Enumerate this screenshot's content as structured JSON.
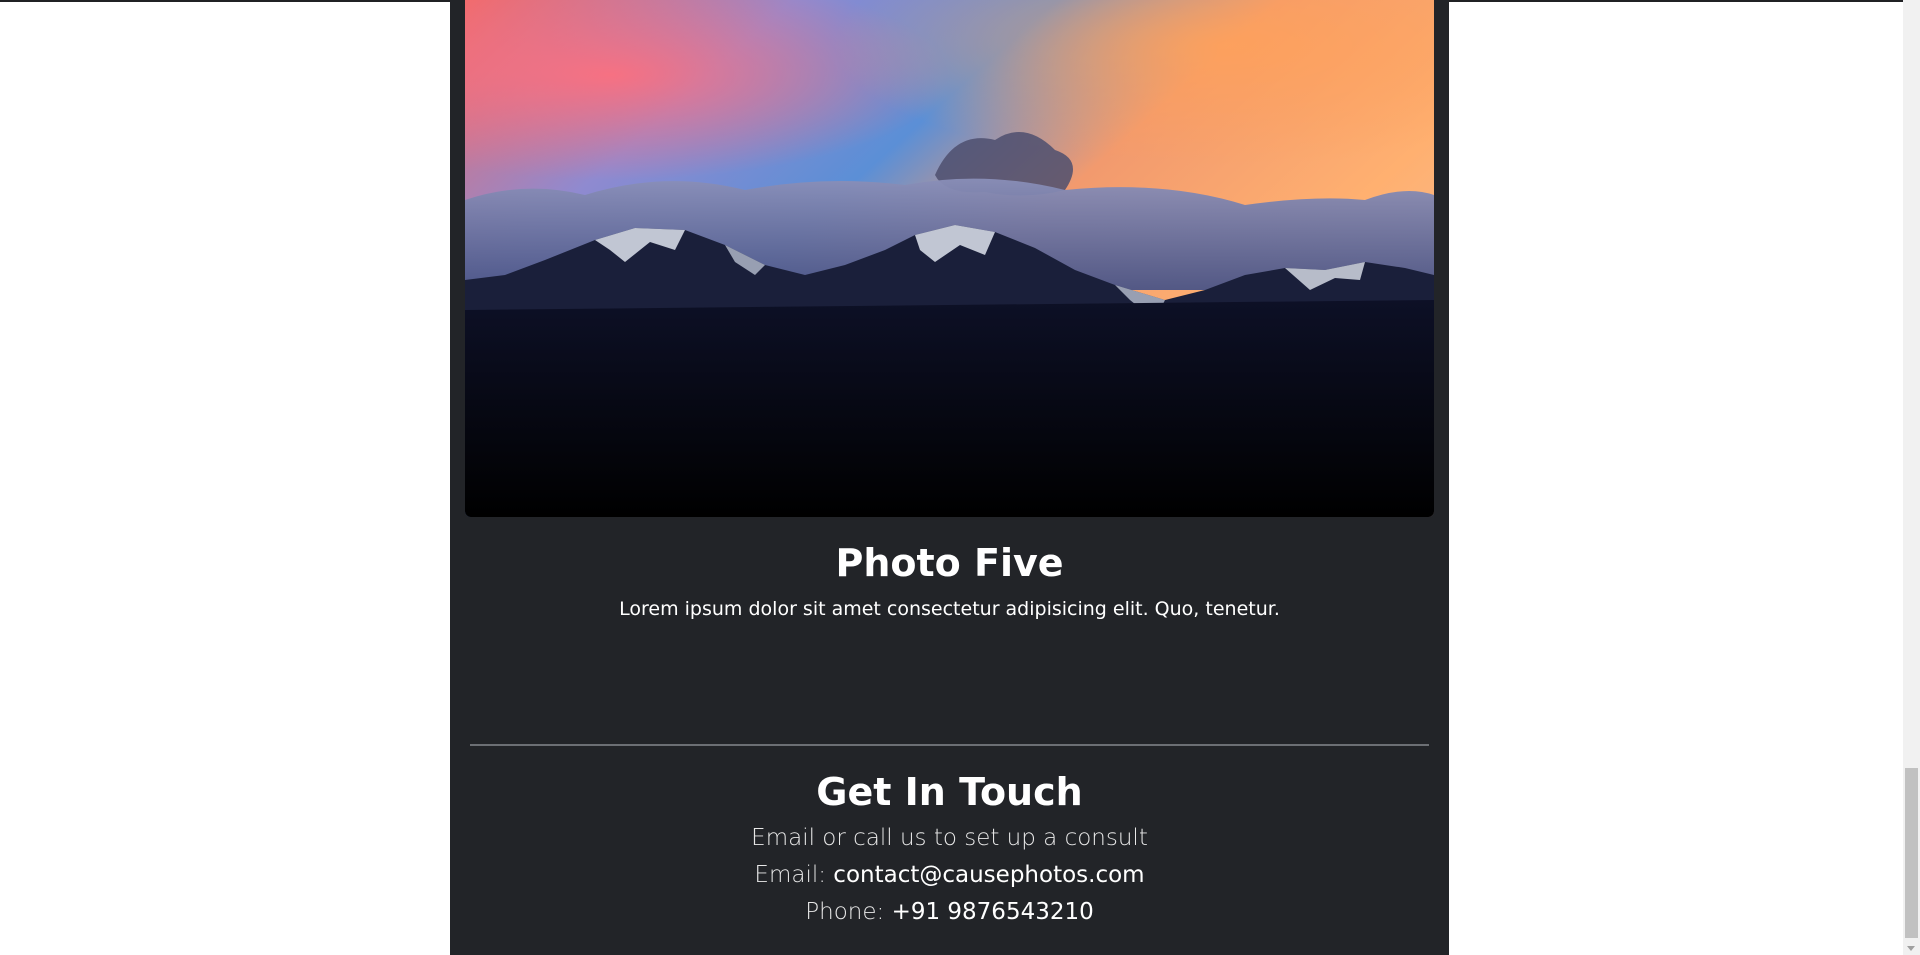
{
  "photo": {
    "title": "Photo Five",
    "description": "Lorem ipsum dolor sit amet consectetur adipisicing elit. Quo, tenetur."
  },
  "contact": {
    "heading": "Get In Touch",
    "tagline": "Email or call us to set up a consult",
    "email_label": "Email: ",
    "email_value": "contact@causephotos.com",
    "phone_label": "Phone: ",
    "phone_value": "+91 9876543210"
  },
  "colors": {
    "page_background": "#ffffff",
    "section_background": "#222428",
    "text": "#ffffff",
    "divider": "#6c6f74"
  },
  "icons": {
    "scroll_down": "chevron-down-icon"
  }
}
